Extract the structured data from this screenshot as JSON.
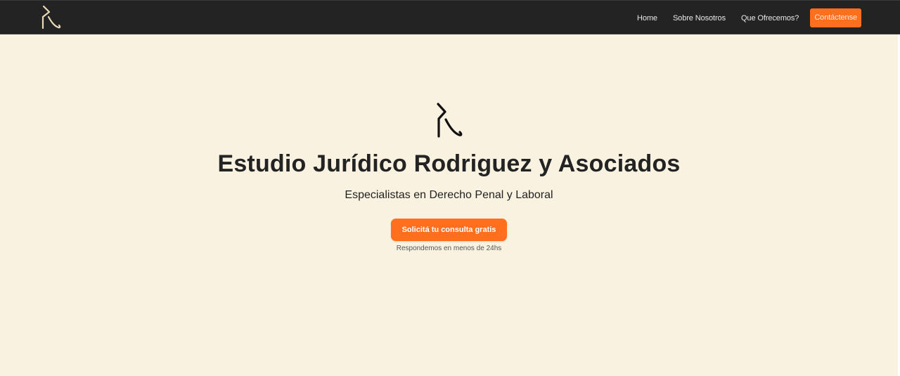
{
  "nav": {
    "logo": "rz-monogram-logo",
    "links": [
      "Home",
      "Sobre Nosotros",
      "Que Ofrecemos?"
    ],
    "cta_label": "Contáctense"
  },
  "hero": {
    "logo": "rz-monogram-logo",
    "title": "Estudio Jurídico Rodriguez y Asociados",
    "subtitle": "Especialistas en Derecho Penal y Laboral",
    "cta_label": "Solicitá tu consulta gratis",
    "note": "Respondemos en menos de 24hs"
  },
  "colors": {
    "navbar_bg": "#232323",
    "page_bg": "#f9f2e1",
    "accent": "#ff6f1e",
    "nav_logo": "#e9d9b8",
    "hero_logo": "#111111"
  }
}
